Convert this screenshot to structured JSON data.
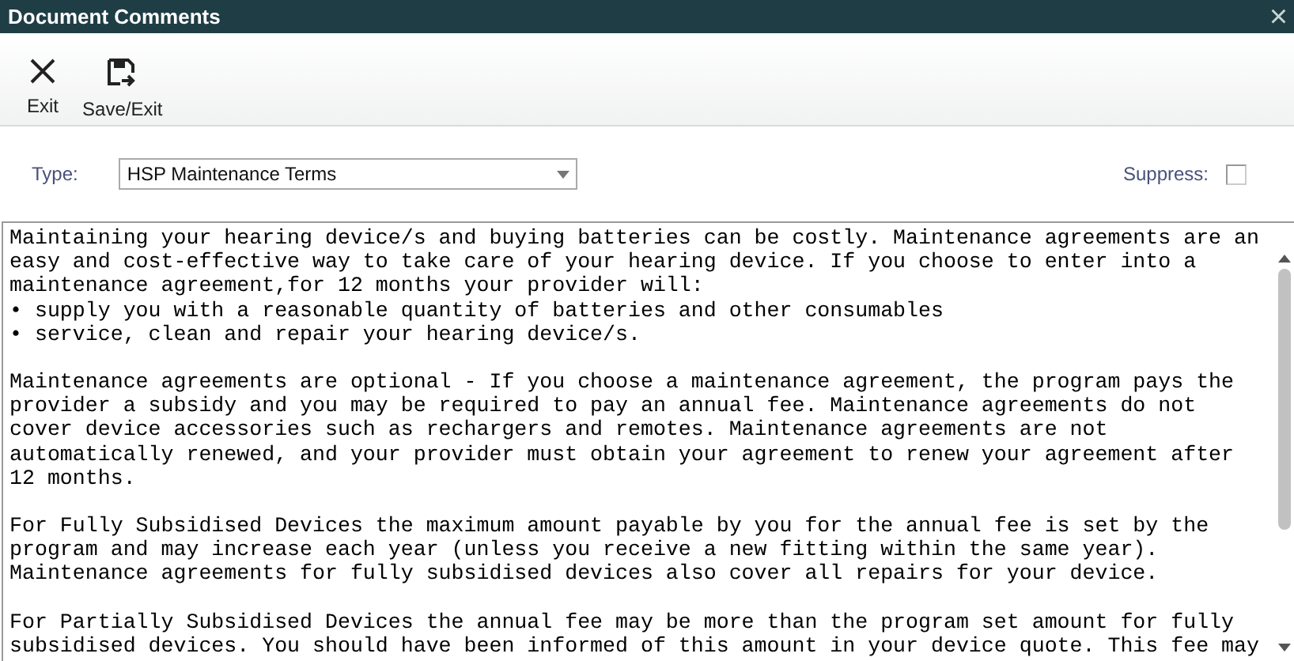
{
  "window": {
    "title": "Document Comments",
    "close": "×"
  },
  "toolbar": [
    {
      "kind": "exit",
      "label": "Exit"
    },
    {
      "kind": "save_exit",
      "label": "Save/Exit"
    }
  ],
  "type_field": {
    "label": "Type:",
    "value": "HSP Maintenance Terms"
  },
  "suppress": {
    "label": "Suppress:",
    "checked": false
  },
  "comment_paragraphs": [
    [
      "Maintaining your hearing device/s and buying batteries can be costly. Maintenance agreements are an",
      "easy and cost-effective way to take care of your hearing device. If you choose to enter into a",
      "maintenance agreement,for 12 months your provider will:",
      "• supply you with a reasonable quantity of batteries and other consumables",
      "• service, clean and repair your hearing device/s."
    ],
    [
      "Maintenance agreements are optional - If you choose a maintenance agreement, the program pays the",
      "provider a subsidy and you may be required to pay an annual fee. Maintenance agreements do not",
      "cover device accessories such as rechargers and remotes. Maintenance agreements are not",
      "automatically renewed, and your provider must obtain your agreement to renew your agreement after",
      "12 months."
    ],
    [
      "For Fully Subsidised Devices the maximum amount payable by you for the annual fee is set by the",
      "program and may increase each year (unless you receive a new fitting within the same year).",
      "Maintenance agreements for fully subsidised devices also cover all repairs for your device."
    ],
    [
      "For Partially Subsidised Devices the annual fee may be more than the program set amount for fully",
      "subsidised devices. You should have been informed of this amount in your device quote. This fee may"
    ]
  ]
}
